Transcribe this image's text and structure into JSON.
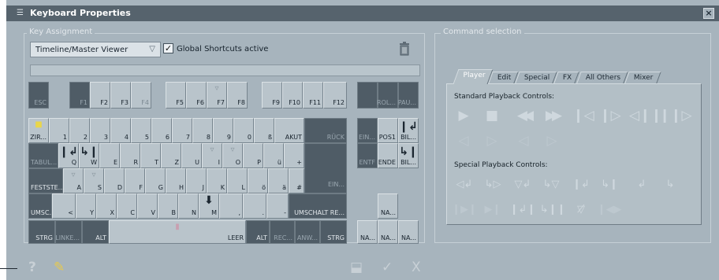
{
  "window": {
    "title": "Keyboard Properties",
    "close_label": "×"
  },
  "key_assignment": {
    "legend": "Key Assignment",
    "context_select": "Timeline/Master Viewer",
    "global_shortcuts_label": "Global Shortcuts active",
    "global_shortcuts_checked": true,
    "check_mark": "✓",
    "dropdown_arrow": "▽"
  },
  "keyboard": {
    "function_row": [
      "ESC",
      "F1",
      "F2",
      "F3",
      "F4",
      "F5",
      "F6",
      "F7",
      "F8",
      "F9",
      "F10",
      "F11",
      "F12",
      "ROL...",
      "PAU..."
    ],
    "number_row": [
      "ZIR...",
      "1",
      "2",
      "3",
      "4",
      "5",
      "6",
      "7",
      "8",
      "9",
      "0",
      "ß",
      "AKUT",
      "RÜCK"
    ],
    "qwertz_row": [
      "TABUL...",
      "Q",
      "W",
      "E",
      "R",
      "T",
      "Z",
      "U",
      "I",
      "O",
      "P",
      "ü",
      "+"
    ],
    "home_row": [
      "FESTSTE...",
      "A",
      "S",
      "D",
      "F",
      "G",
      "H",
      "J",
      "K",
      "L",
      "ö",
      "ä",
      "#",
      "EIN..."
    ],
    "shift_row": [
      "UMSC...",
      "<",
      "Y",
      "X",
      "C",
      "V",
      "B",
      "N",
      "M",
      ",",
      ".",
      "-",
      "UMSCHALT RE..."
    ],
    "bottom_row": [
      "STRG",
      "LINKE...",
      "ALT",
      "LEER",
      "ALT",
      "REC...",
      "ANW...",
      "STRG"
    ],
    "nav_top": [
      "EIN...",
      "POS1",
      "BIL..."
    ],
    "nav_mid": [
      "ENTF",
      "ENDE",
      "BIL..."
    ],
    "numpad": [
      "NA...",
      "NA...",
      "NA...",
      "NA..."
    ],
    "glyphs": {
      "step_back": "❙↲",
      "step_fwd": "↳❙",
      "down_arrow": "⬇",
      "filter": "▿"
    }
  },
  "command_selection": {
    "legend": "Command selection",
    "tabs": [
      "Player",
      "Edit",
      "Special",
      "FX",
      "All Others",
      "Mixer"
    ],
    "active_tab": "Player",
    "standard_label": "Standard Playback Controls:",
    "special_label": "Special Playback Controls:",
    "standard_row1": [
      "▶",
      "■",
      "◀◀",
      "▶▶",
      "❙◁",
      "❙▷",
      "◁❙❙",
      "❙❙▷"
    ],
    "standard_row2": [
      "◁",
      "▷",
      "◁",
      "▷"
    ],
    "special_row1": [
      "◁↲",
      "↳▷",
      "▽↲",
      "↳▽",
      "❙↲",
      "↳❙",
      "↲",
      "↳"
    ],
    "special_row2": [
      "❙▶❙",
      "▶❙",
      "❙↲❙",
      "↳❙❙",
      "▽̸",
      "❙◀▶"
    ]
  },
  "footer": {
    "help": "?",
    "settings": "✎",
    "layout": "⬓",
    "ok": "✓",
    "cancel": "X"
  }
}
